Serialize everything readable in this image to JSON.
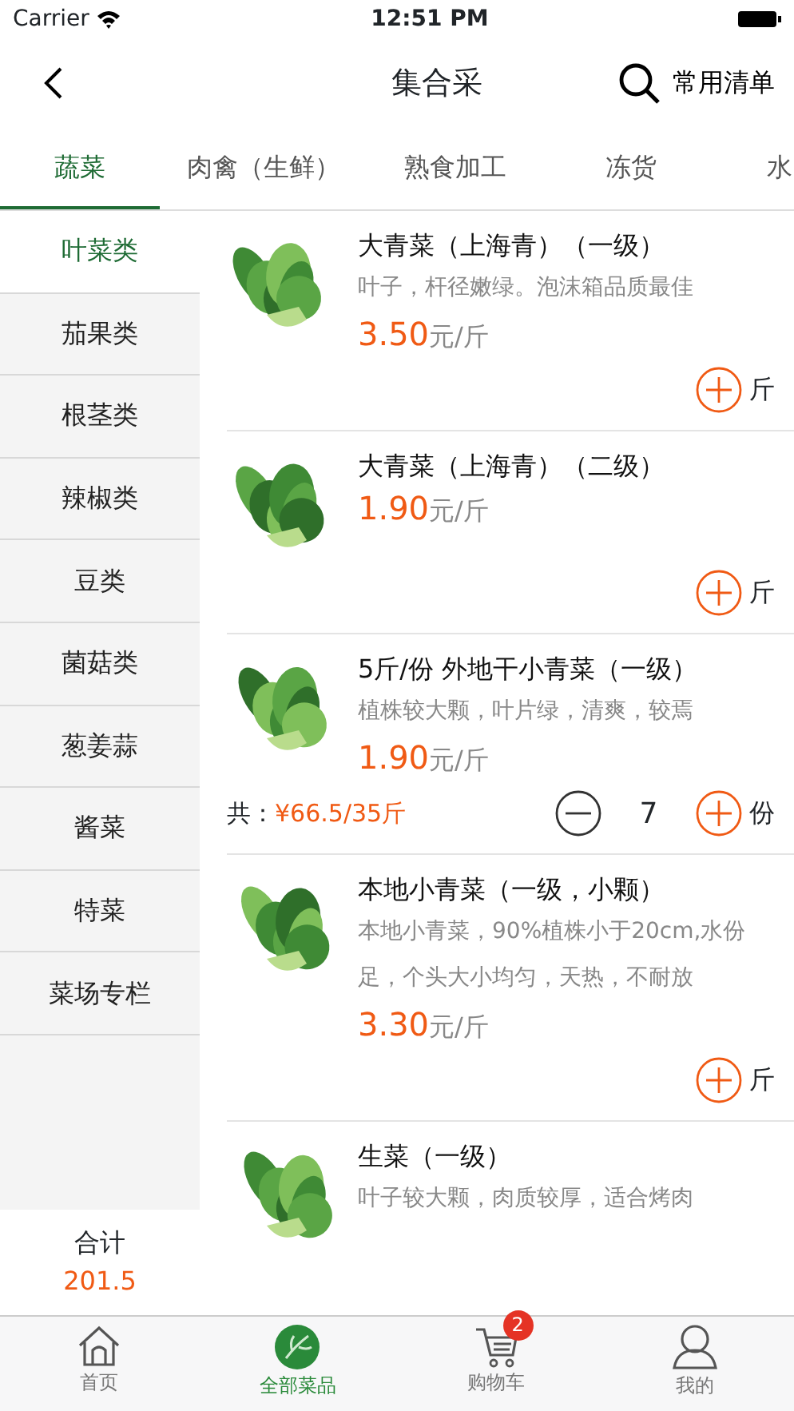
{
  "status_bar": {
    "carrier": "Carrier",
    "time": "12:51 PM"
  },
  "nav": {
    "title": "集合采",
    "action": "常用清单"
  },
  "tabs": [
    {
      "label": "蔬菜",
      "selected": true
    },
    {
      "label": "肉禽（生鲜）",
      "selected": false
    },
    {
      "label": "熟食加工",
      "selected": false
    },
    {
      "label": "冻货",
      "selected": false
    },
    {
      "label": "水",
      "selected": false
    }
  ],
  "sidebar": {
    "items": [
      {
        "label": "叶菜类",
        "selected": true
      },
      {
        "label": "茄果类",
        "selected": false
      },
      {
        "label": "根茎类",
        "selected": false
      },
      {
        "label": "辣椒类",
        "selected": false
      },
      {
        "label": "豆类",
        "selected": false
      },
      {
        "label": "菌菇类",
        "selected": false
      },
      {
        "label": "葱姜蒜",
        "selected": false
      },
      {
        "label": "酱菜",
        "selected": false
      },
      {
        "label": "特菜",
        "selected": false
      },
      {
        "label": "菜场专栏",
        "selected": false
      }
    ],
    "total_label": "合计",
    "total": "201.5"
  },
  "products": [
    {
      "kind": "add",
      "name": "大青菜（上海青）（一级）",
      "desc": "叶子，杆径嫩绿。泡沫箱品质最佳",
      "price": "3.50",
      "price_unit": "元/斤",
      "unit": "斤"
    },
    {
      "kind": "add",
      "name": "大青菜（上海青）（二级）",
      "price": "1.90",
      "price_unit": "元/斤",
      "unit": "斤"
    },
    {
      "kind": "stepper",
      "name": "5斤/份 外地干小青菜（一级）",
      "desc": "植株较大颗，叶片绿，清爽，较焉",
      "price": "1.90",
      "price_unit": "元/斤",
      "total_label": "共：",
      "total": "¥66.5/35斤",
      "quantity": "7",
      "unit": "份"
    },
    {
      "kind": "add",
      "name": "本地小青菜（一级，小颗）",
      "desc": "本地小青菜，90%植株小于20cm,水份足，个头大小均匀，天热，不耐放",
      "price": "3.30",
      "price_unit": "元/斤",
      "unit": "斤"
    },
    {
      "name": "生菜（一级）",
      "desc": "叶子较大颗，肉质较厚，适合烤肉"
    }
  ],
  "tab_bar": [
    {
      "label": "首页",
      "selected": false
    },
    {
      "label": "全部菜品",
      "selected": true
    },
    {
      "label": "购物车",
      "selected": false,
      "badge": "2"
    },
    {
      "label": "我的",
      "selected": false
    }
  ]
}
